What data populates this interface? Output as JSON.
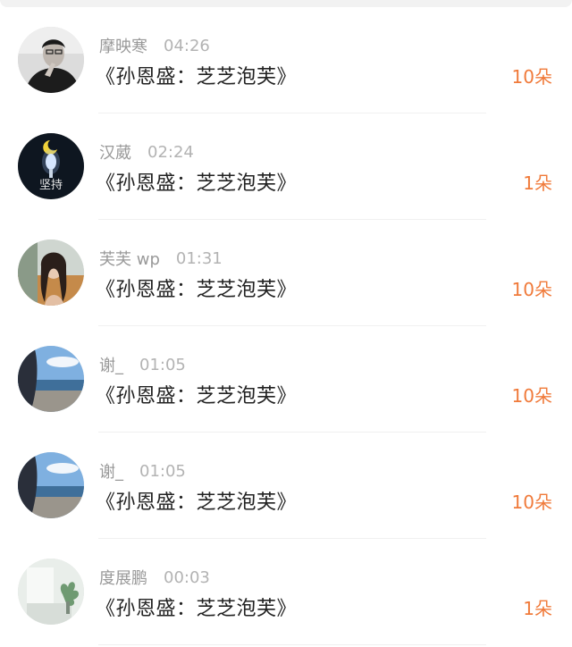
{
  "gift_color": "#f07a3a",
  "rows": [
    {
      "username": "摩映寒",
      "time": "04:26",
      "message": "《孙恩盛：芝芝泡芙》",
      "gift": "10朵",
      "avatar": "man-portrait-avatar"
    },
    {
      "username": "汉葳",
      "time": "02:24",
      "message": "《孙恩盛：芝芝泡芙》",
      "gift": "1朵",
      "avatar": "moon-candle-avatar",
      "avatar_text": "坚持"
    },
    {
      "username": "芙芙 wp",
      "time": "01:31",
      "message": "《孙恩盛：芝芝泡芙》",
      "gift": "10朵",
      "avatar": "woman-portrait-avatar"
    },
    {
      "username": "谢_",
      "time": "01:05",
      "message": "《孙恩盛：芝芝泡芙》",
      "gift": "10朵",
      "avatar": "seaside-avatar"
    },
    {
      "username": "谢_",
      "time": "01:05",
      "message": "《孙恩盛：芝芝泡芙》",
      "gift": "10朵",
      "avatar": "seaside-avatar"
    },
    {
      "username": "度展鹏",
      "time": "00:03",
      "message": "《孙恩盛：芝芝泡芙》",
      "gift": "1朵",
      "avatar": "plant-window-avatar"
    }
  ]
}
